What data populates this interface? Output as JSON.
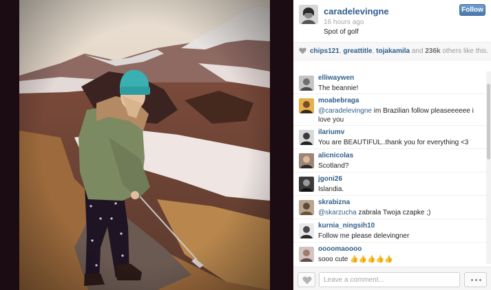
{
  "post": {
    "username": "caradelevingne",
    "timestamp": "16 hours ago",
    "caption": "Spot of golf",
    "follow_label": "Follow"
  },
  "likes": {
    "users": [
      "chips121",
      "greattitle",
      "tojakamila"
    ],
    "sep1": ", ",
    "sep2": ", ",
    "and_text": " and ",
    "count": "236k",
    "suffix": " others like this."
  },
  "comments": [
    {
      "user": "elliwaywen",
      "text": "The beannie!"
    },
    {
      "user": "moabebraga",
      "mention": "@caradelevingne",
      "text": " im Brazilian follow pleaseeeeee i love you"
    },
    {
      "user": "ilariumv",
      "text": "You are BEAUTIFUL..thank you for everything <3"
    },
    {
      "user": "alicnicolas",
      "text": "Scotland?"
    },
    {
      "user": "jgoni26",
      "text": "Islandia."
    },
    {
      "user": "skrabizna",
      "mention": "@skarzucha",
      "text": " zabrala Twoja czapke ;)"
    },
    {
      "user": "kurnia_ningsih10",
      "text": "Follow me please delevingner"
    },
    {
      "user": "oooomaoooo",
      "text": "sooo cute 👍👍👍👍👍"
    }
  ],
  "composer": {
    "placeholder": "Leave a comment..."
  },
  "icons": {
    "like": "heart-icon",
    "likes_indicator": "heart-small-icon",
    "more": "ellipsis-icon"
  },
  "colors": {
    "link": "#2f5e8b",
    "follow_button": "#4978ad",
    "photo_frame": "#1b0c14"
  }
}
